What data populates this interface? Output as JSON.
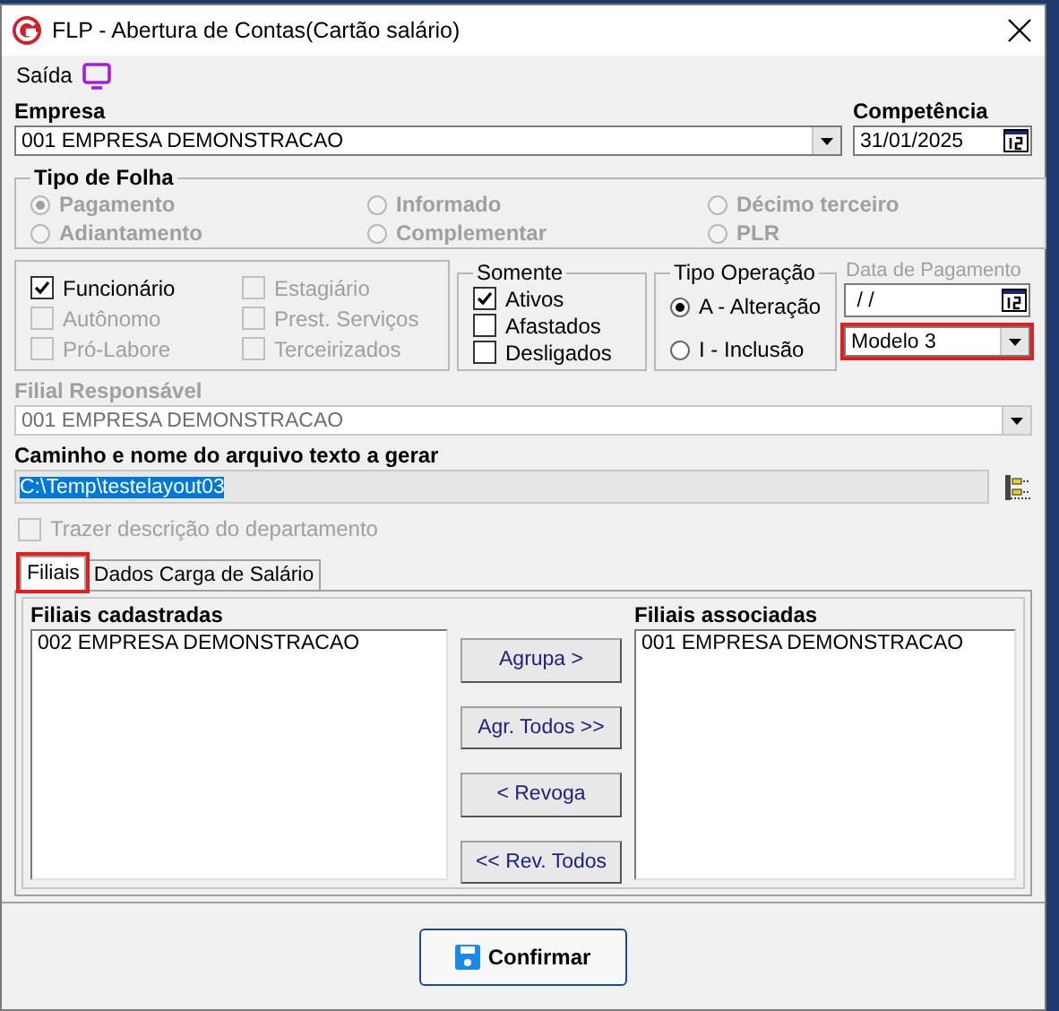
{
  "window": {
    "title": "FLP - Abertura de Contas(Cartão salário)"
  },
  "menu": [
    {
      "label": "Saída"
    }
  ],
  "empresa": {
    "label": "Empresa",
    "value": "001 EMPRESA DEMONSTRACAO"
  },
  "competencia": {
    "label": "Competência",
    "value": "31/01/2025"
  },
  "tipo_folha": {
    "title": "Tipo de Folha",
    "options": [
      {
        "label": "Pagamento",
        "selected": true,
        "disabled": true
      },
      {
        "label": "Adiantamento",
        "selected": false,
        "disabled": true
      },
      {
        "label": "Informado",
        "selected": false,
        "disabled": true
      },
      {
        "label": "Complementar",
        "selected": false,
        "disabled": true
      },
      {
        "label": "Décimo terceiro",
        "selected": false,
        "disabled": true
      },
      {
        "label": "PLR",
        "selected": false,
        "disabled": true
      }
    ]
  },
  "categorias": [
    {
      "label": "Funcionário",
      "checked": true,
      "disabled": false
    },
    {
      "label": "Autônomo",
      "checked": false,
      "disabled": true
    },
    {
      "label": "Pró-Labore",
      "checked": false,
      "disabled": true
    },
    {
      "label": "Estagiário",
      "checked": false,
      "disabled": true
    },
    {
      "label": "Prest. Serviços",
      "checked": false,
      "disabled": true
    },
    {
      "label": "Terceirizados",
      "checked": false,
      "disabled": true
    }
  ],
  "somente": {
    "title": "Somente",
    "options": [
      {
        "label": "Ativos",
        "checked": true
      },
      {
        "label": "Afastados",
        "checked": false
      },
      {
        "label": "Desligados",
        "checked": false
      }
    ]
  },
  "tipo_operacao": {
    "title": "Tipo Operação",
    "options": [
      {
        "label": "A - Alteração",
        "selected": true
      },
      {
        "label": "I - Inclusão",
        "selected": false
      }
    ]
  },
  "data_pagamento": {
    "label": "Data de Pagamento",
    "value": " / /",
    "disabled": true
  },
  "modelo": {
    "value": "Modelo 3",
    "highlighted": true
  },
  "filial_responsavel": {
    "label": "Filial Responsável",
    "value": "001 EMPRESA DEMONSTRACAO",
    "disabled": true
  },
  "caminho": {
    "label": "Caminho e nome do arquivo texto a gerar",
    "value": "C:\\Temp\\testelayout03",
    "text_selected": true
  },
  "trazer_departamento": {
    "label": "Trazer descrição do departamento",
    "checked": false,
    "disabled": true
  },
  "tabs": [
    {
      "label": "Filiais",
      "selected": true,
      "highlighted": true
    },
    {
      "label": "Dados Carga de Salário",
      "selected": false,
      "highlighted": false
    }
  ],
  "filiais_cadastradas": {
    "title": "Filiais cadastradas",
    "items": [
      "002 EMPRESA DEMONSTRACAO"
    ]
  },
  "filiais_associadas": {
    "title": "Filiais associadas",
    "items": [
      "001 EMPRESA DEMONSTRACAO"
    ]
  },
  "transfer_buttons": [
    "Agrupa >",
    "Agr. Todos >>",
    "< Revoga",
    "<< Rev. Todos"
  ],
  "confirm_button": {
    "label": "Confirmar"
  }
}
